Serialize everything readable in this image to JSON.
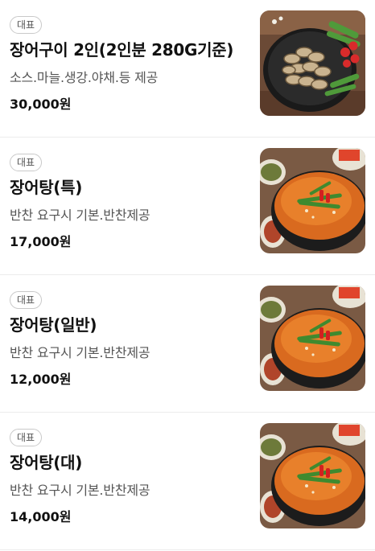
{
  "menu": {
    "items": [
      {
        "badge": "대표",
        "name": "장어구이 2인(2인분 280G기준)",
        "desc": "소스.마늘.생강.야채.등 제공",
        "price": "30,000원",
        "image": "grilled-eel-photo"
      },
      {
        "badge": "대표",
        "name": "장어탕(특)",
        "desc": "반찬 요구시 기본.반찬제공",
        "price": "17,000원",
        "image": "eel-soup-photo"
      },
      {
        "badge": "대표",
        "name": "장어탕(일반)",
        "desc": "반찬 요구시 기본.반찬제공",
        "price": "12,000원",
        "image": "eel-soup-photo"
      },
      {
        "badge": "대표",
        "name": "장어탕(대)",
        "desc": "반찬 요구시 기본.반찬제공",
        "price": "14,000원",
        "image": "eel-soup-photo"
      }
    ]
  }
}
